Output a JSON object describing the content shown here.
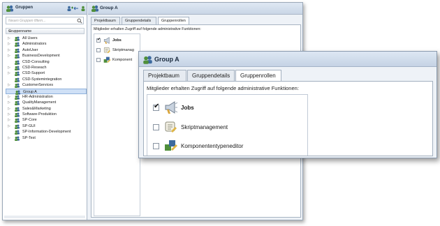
{
  "sidebar": {
    "title": "Gruppen",
    "search_placeholder": "Neuen Gruppen filtern...",
    "column_header": "Gruppenname",
    "column_arrow": "∨",
    "items": [
      {
        "label": "All Users",
        "expand": "▷"
      },
      {
        "label": "Administrators",
        "expand": "▷"
      },
      {
        "label": "AutoUser",
        "expand": "▷"
      },
      {
        "label": "BusinessDevelopment",
        "expand": "▷"
      },
      {
        "label": "CSD-Consulting",
        "expand": ""
      },
      {
        "label": "CSD-Reseach",
        "expand": "▷"
      },
      {
        "label": "CSD-Support",
        "expand": "▷"
      },
      {
        "label": "CSD-Systemintegration",
        "expand": ""
      },
      {
        "label": "CustomerServices",
        "expand": "▷"
      },
      {
        "label": "Group A",
        "expand": ""
      },
      {
        "label": "HR-Administration",
        "expand": "▷"
      },
      {
        "label": "QualityManagement",
        "expand": "▷"
      },
      {
        "label": "Sales&Marketing",
        "expand": "▷"
      },
      {
        "label": "Software-Produktion",
        "expand": "▷"
      },
      {
        "label": "SP-Core",
        "expand": "▷"
      },
      {
        "label": "SP-GUI",
        "expand": "▷"
      },
      {
        "label": "SP-Information-Development",
        "expand": ""
      },
      {
        "label": "SP-Test",
        "expand": "▷"
      }
    ],
    "selected_index": 9
  },
  "main": {
    "title": "Group A",
    "tabs": [
      {
        "label": "Projektbaum"
      },
      {
        "label": "Gruppendetails"
      },
      {
        "label": "Gruppenrollen"
      }
    ],
    "active_tab": 2,
    "info_text": "Mitglieder erhalten Zugriff auf folgende administrative Funktionen:",
    "roles": [
      {
        "label": "Jobs",
        "checked": true,
        "check_glyph": "✔",
        "icon": "jobs-megaphone-icon"
      },
      {
        "label": "Skriptmanagement",
        "checked": false,
        "check_glyph": "",
        "icon": "script-scroll-icon"
      },
      {
        "label": "Komponententypeneditor",
        "checked": false,
        "check_glyph": "",
        "icon": "component-editor-icon"
      }
    ],
    "roles_small_visible": [
      "Jobs",
      "Skriptmanag",
      "Komponent"
    ]
  },
  "zoom": {
    "title": "Group A",
    "tabs": [
      {
        "label": "Projektbaum"
      },
      {
        "label": "Gruppendetails"
      },
      {
        "label": "Gruppenrollen"
      }
    ],
    "info_text": "Mitglieder erhalten Zugriff auf folgende administrative Funktionen:"
  },
  "colors": {
    "header_gradient_top": "#dfe8f3",
    "header_gradient_bottom": "#c9d6e6",
    "selection": "#cfe0f6",
    "group_icon_front": "#4f8f3a",
    "group_icon_back": "#3d6a9e"
  }
}
